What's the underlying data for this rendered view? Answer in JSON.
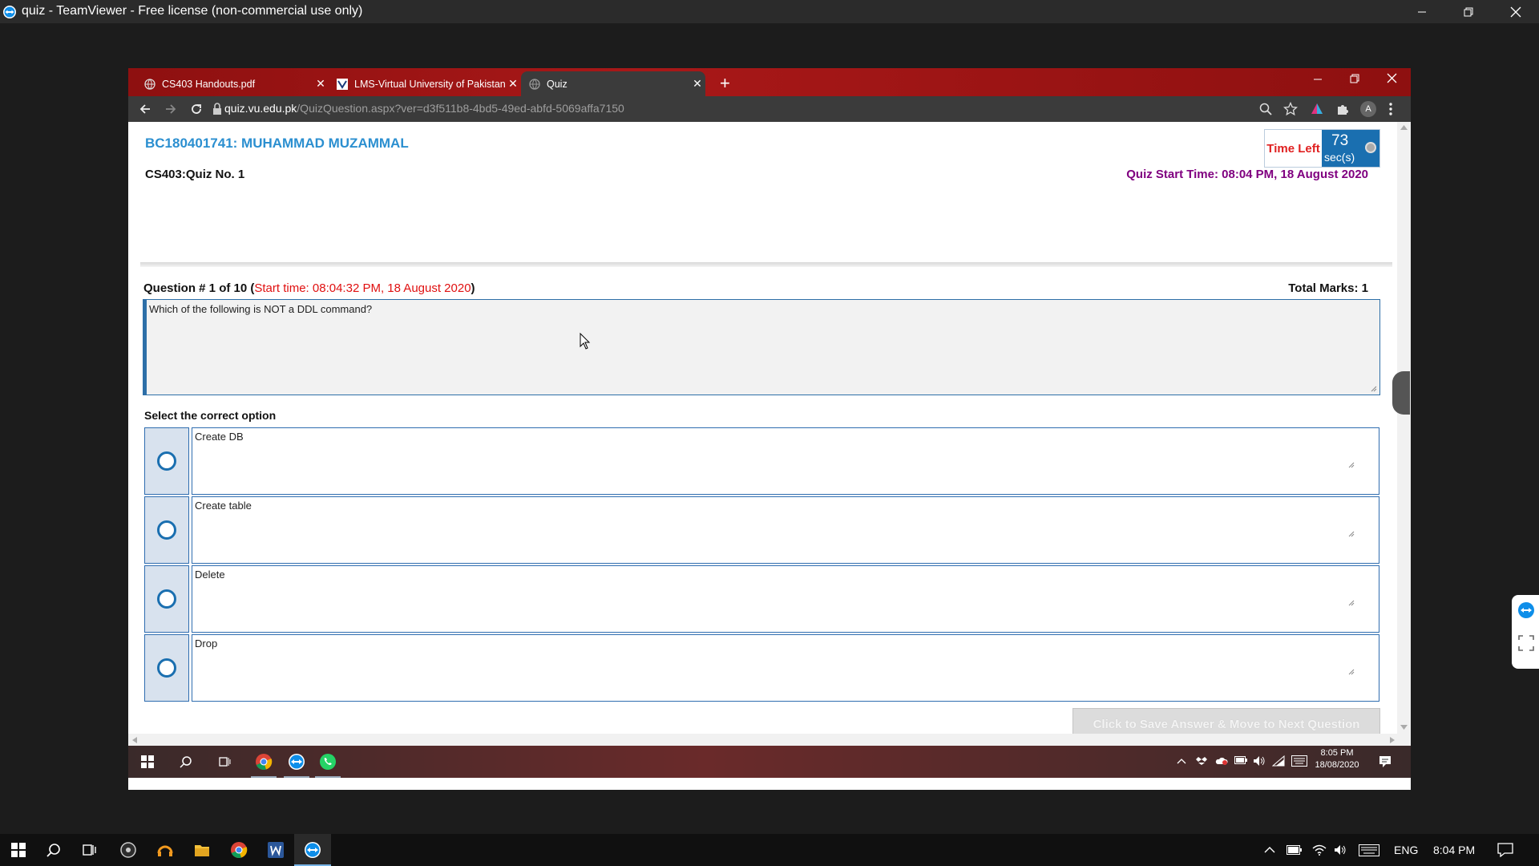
{
  "teamviewer": {
    "window_title": "quiz - TeamViewer - Free license (non-commercial use only)"
  },
  "browser": {
    "tabs": [
      {
        "label": "CS403 Handouts.pdf",
        "active": false
      },
      {
        "label": "LMS-Virtual University of Pakistan",
        "active": false
      },
      {
        "label": "Quiz",
        "active": true
      }
    ],
    "new_tab": "+",
    "url_host": "quiz.vu.edu.pk",
    "url_path": "/QuizQuestion.aspx?ver=d3f511b8-4bd5-49ed-abfd-5069affa7150",
    "profile_initial": "A"
  },
  "quiz": {
    "student": "BC180401741: MUHAMMAD MUZAMMAL",
    "title": "CS403:Quiz No. 1",
    "start_time_label": "Quiz Start Time: 08:04 PM, 18 August 2020",
    "timer": {
      "label": "Time Left",
      "value": "73",
      "unit": "sec(s)"
    },
    "question_prefix": "Question # 1 of 10 (",
    "question_start": "Start time: 08:04:32 PM, 18 August 2020",
    "question_suffix": ")",
    "total_marks": "Total Marks: 1",
    "question_text": "Which of the following is NOT a DDL command?",
    "select_label": "Select the correct option",
    "options": [
      "Create DB",
      "Create table",
      "Delete",
      "Drop"
    ],
    "save_button": "Click to Save Answer & Move to Next Question"
  },
  "remote_taskbar": {
    "time": "8:05 PM",
    "date": "18/08/2020"
  },
  "taskbar": {
    "language": "ENG",
    "time": "8:04 PM"
  },
  "colors": {
    "tabstrip": "#a81818",
    "student_name": "#2b8fd0",
    "start_time": "#800080",
    "timer_bg": "#1a6fb0",
    "red_text": "#e01010"
  }
}
